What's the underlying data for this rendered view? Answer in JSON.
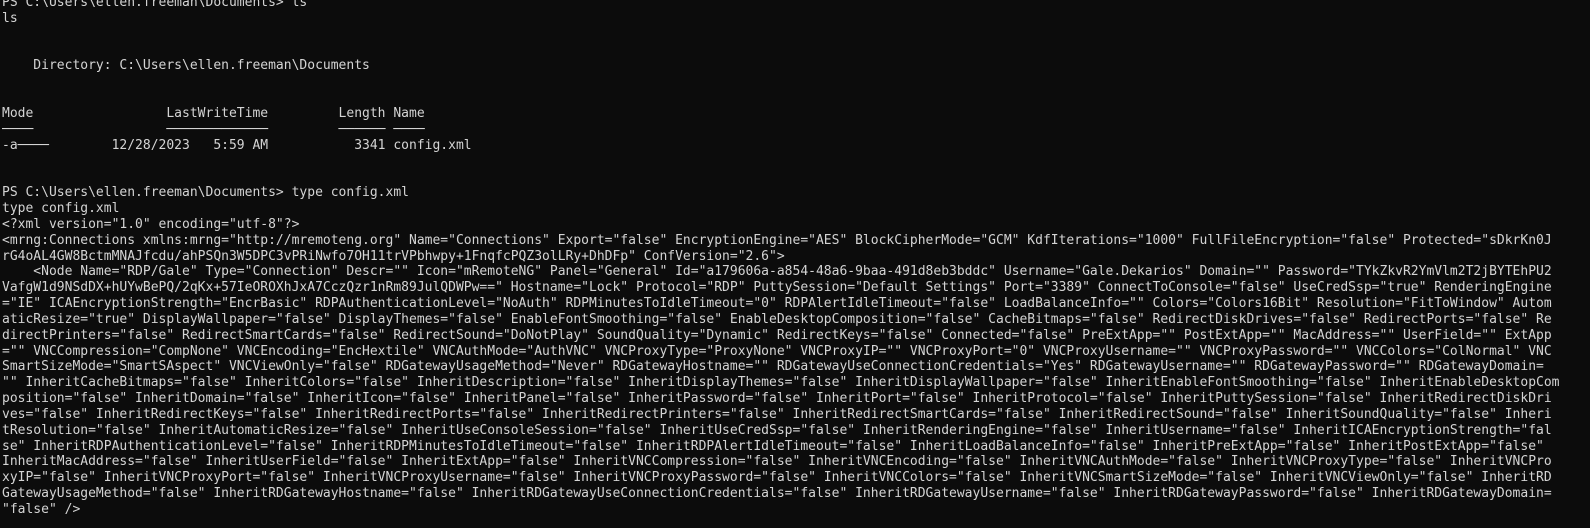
{
  "terminal": {
    "lines": [
      "PS C:\\Users\\ellen.freeman\\Documents> ls",
      "ls",
      "",
      "",
      "    Directory: C:\\Users\\ellen.freeman\\Documents",
      "",
      "",
      "Mode                 LastWriteTime         Length Name",
      "────                 ─────────────         ────── ────",
      "-a────        12/28/2023   5:59 AM           3341 config.xml",
      "",
      "",
      "PS C:\\Users\\ellen.freeman\\Documents> type config.xml",
      "type config.xml",
      "<?xml version=\"1.0\" encoding=\"utf-8\"?>",
      "<mrng:Connections xmlns:mrng=\"http://mremoteng.org\" Name=\"Connections\" Export=\"false\" EncryptionEngine=\"AES\" BlockCipherMode=\"GCM\" KdfIterations=\"1000\" FullFileEncryption=\"false\" Protected=\"sDkrKn0J",
      "rG4oAL4GW8BctmMNAJfcdu/ahPSQn3W5DPC3vPRiNwfo7OH11trVPbhwpy+1FnqfcPQZ3olLRy+DhDFp\" ConfVersion=\"2.6\">",
      "    <Node Name=\"RDP/Gale\" Type=\"Connection\" Descr=\"\" Icon=\"mRemoteNG\" Panel=\"General\" Id=\"a179606a-a854-48a6-9baa-491d8eb3bddc\" Username=\"Gale.Dekarios\" Domain=\"\" Password=\"TYkZkvR2YmVlm2T2jBYTEhPU2",
      "VafgW1d9NSdDX+hUYwBePQ/2qKx+57IeOROXhJxA7CczQzr1nRm89JulQDWPw==\" Hostname=\"Lock\" Protocol=\"RDP\" PuttySession=\"Default Settings\" Port=\"3389\" ConnectToConsole=\"false\" UseCredSsp=\"true\" RenderingEngine",
      "=\"IE\" ICAEncryptionStrength=\"EncrBasic\" RDPAuthenticationLevel=\"NoAuth\" RDPMinutesToIdleTimeout=\"0\" RDPAlertIdleTimeout=\"false\" LoadBalanceInfo=\"\" Colors=\"Colors16Bit\" Resolution=\"FitToWindow\" Autom",
      "aticResize=\"true\" DisplayWallpaper=\"false\" DisplayThemes=\"false\" EnableFontSmoothing=\"false\" EnableDesktopComposition=\"false\" CacheBitmaps=\"false\" RedirectDiskDrives=\"false\" RedirectPorts=\"false\" Re",
      "directPrinters=\"false\" RedirectSmartCards=\"false\" RedirectSound=\"DoNotPlay\" SoundQuality=\"Dynamic\" RedirectKeys=\"false\" Connected=\"false\" PreExtApp=\"\" PostExtApp=\"\" MacAddress=\"\" UserField=\"\" ExtApp",
      "=\"\" VNCCompression=\"CompNone\" VNCEncoding=\"EncHextile\" VNCAuthMode=\"AuthVNC\" VNCProxyType=\"ProxyNone\" VNCProxyIP=\"\" VNCProxyPort=\"0\" VNCProxyUsername=\"\" VNCProxyPassword=\"\" VNCColors=\"ColNormal\" VNC",
      "SmartSizeMode=\"SmartSAspect\" VNCViewOnly=\"false\" RDGatewayUsageMethod=\"Never\" RDGatewayHostname=\"\" RDGatewayUseConnectionCredentials=\"Yes\" RDGatewayUsername=\"\" RDGatewayPassword=\"\" RDGatewayDomain=",
      "\"\" InheritCacheBitmaps=\"false\" InheritColors=\"false\" InheritDescription=\"false\" InheritDisplayThemes=\"false\" InheritDisplayWallpaper=\"false\" InheritEnableFontSmoothing=\"false\" InheritEnableDesktopCom",
      "position=\"false\" InheritDomain=\"false\" InheritIcon=\"false\" InheritPanel=\"false\" InheritPassword=\"false\" InheritPort=\"false\" InheritProtocol=\"false\" InheritPuttySession=\"false\" InheritRedirectDiskDri",
      "ves=\"false\" InheritRedirectKeys=\"false\" InheritRedirectPorts=\"false\" InheritRedirectPrinters=\"false\" InheritRedirectSmartCards=\"false\" InheritRedirectSound=\"false\" InheritSoundQuality=\"false\" Inheri",
      "tResolution=\"false\" InheritAutomaticResize=\"false\" InheritUseConsoleSession=\"false\" InheritUseCredSsp=\"false\" InheritRenderingEngine=\"false\" InheritUsername=\"false\" InheritICAEncryptionStrength=\"fal",
      "se\" InheritRDPAuthenticationLevel=\"false\" InheritRDPMinutesToIdleTimeout=\"false\" InheritRDPAlertIdleTimeout=\"false\" InheritLoadBalanceInfo=\"false\" InheritPreExtApp=\"false\" InheritPostExtApp=\"false\"",
      "InheritMacAddress=\"false\" InheritUserField=\"false\" InheritExtApp=\"false\" InheritVNCCompression=\"false\" InheritVNCEncoding=\"false\" InheritVNCAuthMode=\"false\" InheritVNCProxyType=\"false\" InheritVNCPro",
      "xyIP=\"false\" InheritVNCProxyPort=\"false\" InheritVNCProxyUsername=\"false\" InheritVNCProxyPassword=\"false\" InheritVNCColors=\"false\" InheritVNCSmartSizeMode=\"false\" InheritVNCViewOnly=\"false\" InheritRD",
      "GatewayUsageMethod=\"false\" InheritRDGatewayHostname=\"false\" InheritRDGatewayUseConnectionCredentials=\"false\" InheritRDGatewayUsername=\"false\" InheritRDGatewayPassword=\"false\" InheritRDGatewayDomain=",
      "\"false\" />"
    ]
  }
}
